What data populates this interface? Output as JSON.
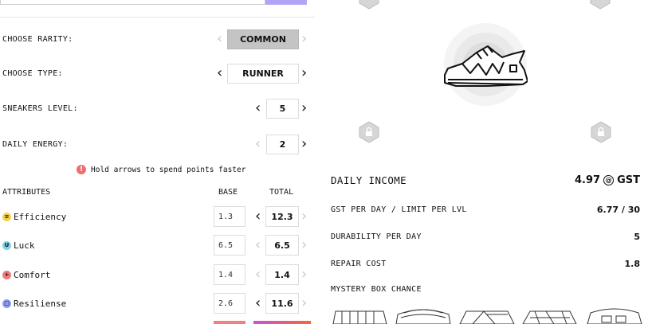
{
  "config": {
    "rarity_label": "CHOOSE RARITY:",
    "rarity_value": "COMMON",
    "type_label": "CHOOSE TYPE:",
    "type_value": "RUNNER",
    "level_label": "SNEAKERS LEVEL:",
    "level_value": "5",
    "energy_label": "DAILY ENERGY:",
    "energy_value": "2"
  },
  "hint": {
    "icon": "exclamation-icon",
    "text": "Hold arrows to spend points faster",
    "color": "#ef6f6f"
  },
  "attributes": {
    "header": "ATTRIBUTES",
    "base_header": "BASE",
    "total_header": "TOTAL",
    "rows": [
      {
        "name": "Efficiency",
        "icon": "efficiency-icon",
        "icon_color": "#f3d34a",
        "glyph": "≡",
        "base": "1.3",
        "total": "12.3",
        "left_active": true
      },
      {
        "name": "Luck",
        "icon": "luck-icon",
        "icon_color": "#7fd3e6",
        "glyph": "U",
        "base": "6.5",
        "total": "6.5",
        "left_active": false
      },
      {
        "name": "Comfort",
        "icon": "comfort-icon",
        "icon_color": "#f07a7a",
        "glyph": "+",
        "base": "1.4",
        "total": "1.4",
        "left_active": false
      },
      {
        "name": "Resiliense",
        "icon": "resilience-icon",
        "icon_color": "#8a9ff0",
        "glyph": "□",
        "base": "2.6",
        "total": "11.6",
        "left_active": true
      }
    ]
  },
  "income": {
    "daily_income_label": "DAILY INCOME",
    "daily_income_value": "4.97",
    "daily_income_unit": "GST",
    "coin_glyph": "@",
    "gst_per_day_label": "GST PER DAY / LIMIT PER LVL",
    "gst_per_day_value": "6.77 / 30",
    "durability_label": "DURABILITY PER DAY",
    "durability_value": "5",
    "repair_label": "REPAIR COST",
    "repair_value": "1.8",
    "mystery_label": "MYSTERY BOX CHANCE"
  },
  "colors": {
    "accent_purple": "#b3a5f5",
    "lock_gray": "#c9c9c9",
    "rarity_gray": "#c4c4c4"
  }
}
